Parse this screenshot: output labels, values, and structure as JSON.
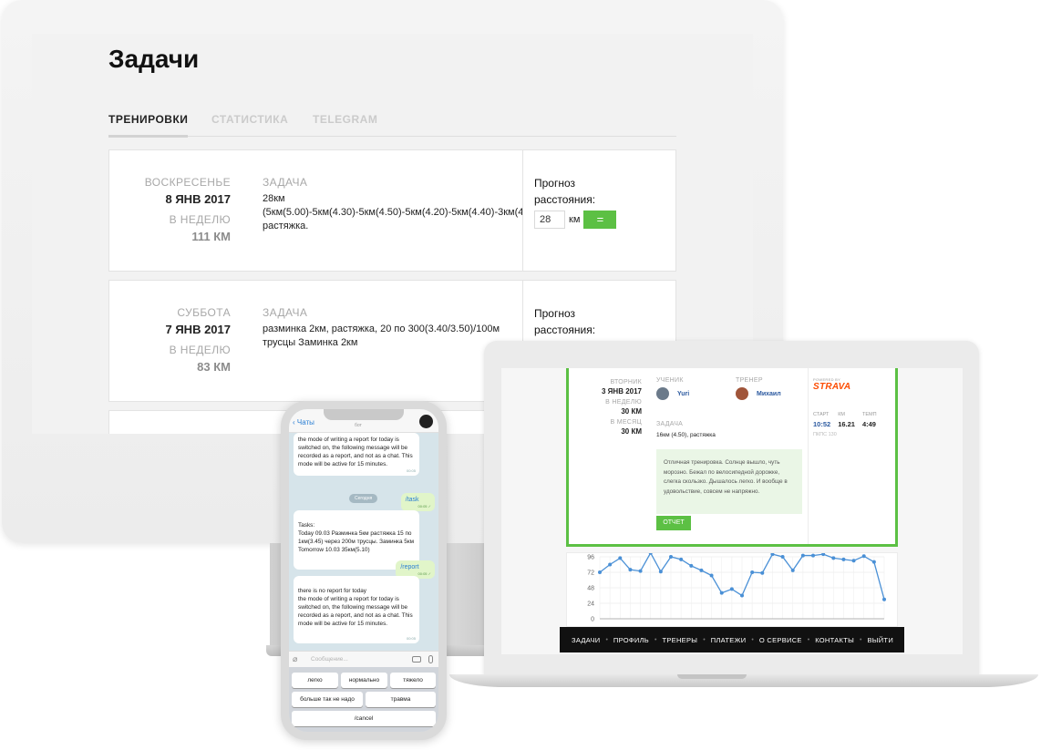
{
  "monitor": {
    "title": "Задачи",
    "tabs": [
      {
        "label": "ТРЕНИРОВКИ",
        "active": true
      },
      {
        "label": "СТАТИСТИКА",
        "active": false
      },
      {
        "label": "TELEGRAM",
        "active": false
      }
    ],
    "cards": [
      {
        "day": "ВОСКРЕСЕНЬЕ",
        "date": "8 ЯНВ 2017",
        "week_label": "В НЕДЕЛЮ",
        "week_km": "111 КМ",
        "task_header": "ЗАДАЧА",
        "task_text": "28км\n(5км(5.00)-5км(4.30)-5км(4.50)-5км(4.20)-5км(4.40)-3км(4\nрастяжка.",
        "forecast_label": "Прогноз расстояния:",
        "forecast_value": "28",
        "forecast_unit": "км",
        "forecast_button": "="
      },
      {
        "day": "СУББОТА",
        "date": "7 ЯНВ 2017",
        "week_label": "В НЕДЕЛЮ",
        "week_km": "83 КМ",
        "task_header": "ЗАДАЧА",
        "task_text": "разминка 2км, растяжка, 20 по 300(3.40/3.50)/100м\nтрусцы Заминка 2км",
        "forecast_label": "Прогноз расстояния:"
      }
    ]
  },
  "laptop": {
    "day": "ВТОРНИК",
    "date": "3 ЯНВ 2017",
    "week_label": "В НЕДЕЛЮ",
    "week_km": "30 КМ",
    "month_label": "В МЕСЯЦ",
    "month_km": "30 КМ",
    "student_header": "УЧЕНИК",
    "student_name": "Yuri",
    "coach_header": "ТРЕНЕР",
    "coach_name": "Михаил",
    "task_header": "ЗАДАЧА",
    "task_text": "16км (4.50), растяжка",
    "report_text": "Отличная тренировка. Солнце вышло, чуть морозно. Бежал по велосипедной дорожке, слегка скользко. Дышалось легко. И вообще в удовольствие, совсем не напряжно.",
    "report_button": "ОТЧЕТ",
    "powered_by": "POWERED BY",
    "strava": "STRAVA",
    "stats": [
      {
        "label": "СТАРТ",
        "value": "10:52"
      },
      {
        "label": "КМ",
        "value": "16.21"
      },
      {
        "label": "ТЕМП",
        "value": "4:49"
      }
    ],
    "pace_note": "ПКПС 130",
    "nav": [
      "ЗАДАЧИ",
      "ПРОФИЛЬ",
      "ТРЕНЕРЫ",
      "ПЛАТЕЖИ",
      "О СЕРВИСЕ",
      "КОНТАКТЫ",
      "ВЫЙТИ"
    ],
    "nav_separator": "•"
  },
  "chart_data": {
    "type": "line",
    "ylim": [
      0,
      96
    ],
    "yticks": [
      0,
      24,
      48,
      72,
      96
    ],
    "x": [
      1,
      2,
      3,
      4,
      5,
      6,
      7,
      8,
      9,
      10,
      11,
      12,
      13,
      14,
      15,
      16,
      17,
      18,
      19,
      20,
      21,
      22,
      23,
      24,
      25,
      26,
      27,
      28,
      29
    ],
    "values": [
      72,
      84,
      94,
      76,
      74,
      102,
      73,
      96,
      92,
      82,
      75,
      67,
      40,
      46,
      36,
      72,
      71,
      100,
      96,
      75,
      98,
      98,
      100,
      94,
      92,
      90,
      97,
      88,
      30
    ],
    "color": "#4a90d6"
  },
  "phone": {
    "back_label": "Чаты",
    "chat_subtitle": "бот",
    "messages": [
      {
        "dir": "in",
        "text": "the mode of writing a report for today is switched on, the following message will be recorded as a report, and not as a chat. This mode will be active for 15 minutes.",
        "time": "00:05"
      },
      {
        "dir": "out",
        "text": "/task",
        "time": "00:05 ✓"
      },
      {
        "dir": "in",
        "text": "Tasks:\nToday 09.03 Разминка 5км растяжка 15 по 1км(3.45) через 200м трусцы. Заминка 5км\nTomorrow 10.03 35км(5.10)",
        "time": "00:05"
      },
      {
        "dir": "out",
        "text": "/report",
        "time": "00:05 ✓"
      },
      {
        "dir": "in",
        "text": "there is no report for today\nthe mode of writing a report for today is switched on, the following message will be recorded as a report, and not as a chat. This mode will be active for 15 minutes.",
        "time": "00:05"
      }
    ],
    "today_label": "Сегодня",
    "input_placeholder": "Сообщение...",
    "keys": [
      "легко",
      "нормально",
      "тяжело",
      "больше так не надо",
      "травма",
      "/cancel"
    ]
  },
  "colors": {
    "accent_green": "#5cc044",
    "strava_orange": "#fc4c02",
    "link_blue": "#2c5aa0",
    "telegram_blue": "#2a7fd4"
  }
}
